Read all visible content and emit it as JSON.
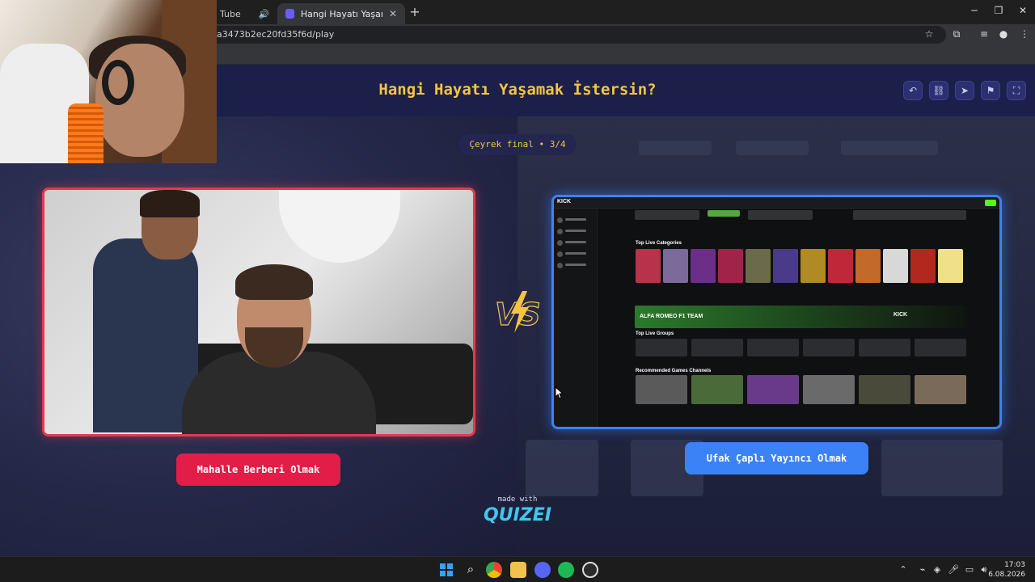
{
  "browser": {
    "tabs": [
      {
        "label": "Tube"
      },
      {
        "label": "Hangi Hayatı Yaşamak İstersin?"
      }
    ],
    "url": "a3473b2ec20fd35f6d/play"
  },
  "game": {
    "title": "Hangi Hayatı Yaşamak İstersin?",
    "round": "Çeyrek final • 3/4",
    "left_option": {
      "label": "Mahalle Berberi Olmak"
    },
    "right_option": {
      "label": "Ufak Çaplı Yayıncı Olmak"
    },
    "vs": "VS",
    "made_with": "made with",
    "brand": "QUIZEI"
  },
  "kick_preview": {
    "logo": "KICK",
    "categories_heading": "Top Live Categories",
    "groups_heading": "Top Live Groups",
    "recommended_heading": "Recommended Games Channels",
    "banner_text": "ALFA ROMEO F1 TEAM",
    "banner_brand": "KICK"
  },
  "taskbar": {
    "time": "17:03",
    "date": "6.08.2026"
  },
  "colors": {
    "title": "#f5c542",
    "left_accent": "#e11d48",
    "right_accent": "#3b82f6",
    "brand": "#3fc7f0"
  }
}
